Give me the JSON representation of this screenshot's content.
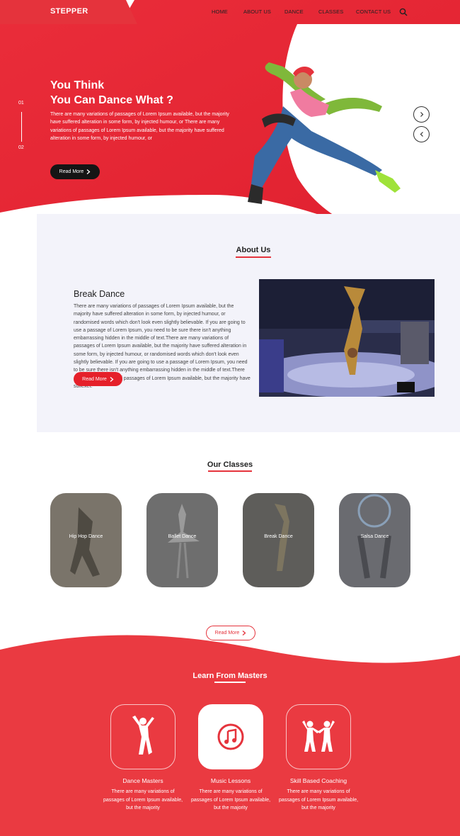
{
  "brand": {
    "logo": "STEPPER",
    "accent": "#e5333c",
    "dark": "#151515"
  },
  "nav": {
    "items": [
      "HOME",
      "ABOUT US",
      "DANCE",
      "CLASSES",
      "CONTACT US"
    ],
    "search_icon": "search-icon"
  },
  "hero": {
    "slide_numbers": [
      "01",
      "02"
    ],
    "title_line1": "You Think",
    "title_line2": "You Can Dance What ?",
    "text": "There are many variations of passages of Lorem Ipsum available, but the majority have suffered alteration in some form, by injected humour, or There are many variations of passages of Lorem Ipsum available, but the majority have suffered alteration in some form, by injected humour, or",
    "button": "Read More",
    "arrows": [
      "›",
      "‹"
    ]
  },
  "about": {
    "section_title": "About Us",
    "heading": "Break Dance",
    "text": "There are many variations of passages of Lorem Ipsum available, but the majority have suffered alteration in some form, by injected humour, or randomised words which don't look even slightly believable. If you are going to use a passage of Lorem Ipsum, you need to be sure there isn't anything embarrassing hidden in the middle of text.There are many variations of passages of Lorem Ipsum available, but the majority have suffered alteration in some form, by injected humour, or randomised words which don't look even slightly believable. If you are going to use a passage of Lorem Ipsum, you need to be sure there isn't anything embarrassing hidden in the middle of text.There are many variations of passages of Lorem Ipsum available, but the majority have suffexet.",
    "button": "Read More"
  },
  "classes": {
    "section_title": "Our Classes",
    "items": [
      "Hip Hop Dance",
      "Ballet Dance",
      "Break Dance",
      "Salsa Dance"
    ],
    "button": "Read More"
  },
  "masters": {
    "section_title": "Learn From Masters",
    "items": [
      {
        "title": "Dance Masters",
        "text": "There are many variations of passages of Lorem Ipsum available, but the majority",
        "icon": "dancer-icon"
      },
      {
        "title": "Music Lessons",
        "text": "There are many variations of passages of Lorem Ipsum available, but the majority",
        "icon": "music-note-icon"
      },
      {
        "title": "Skill Based Coaching",
        "text": "There are many variations of passages of Lorem Ipsum available, but the majority",
        "icon": "coaching-icon"
      }
    ]
  }
}
